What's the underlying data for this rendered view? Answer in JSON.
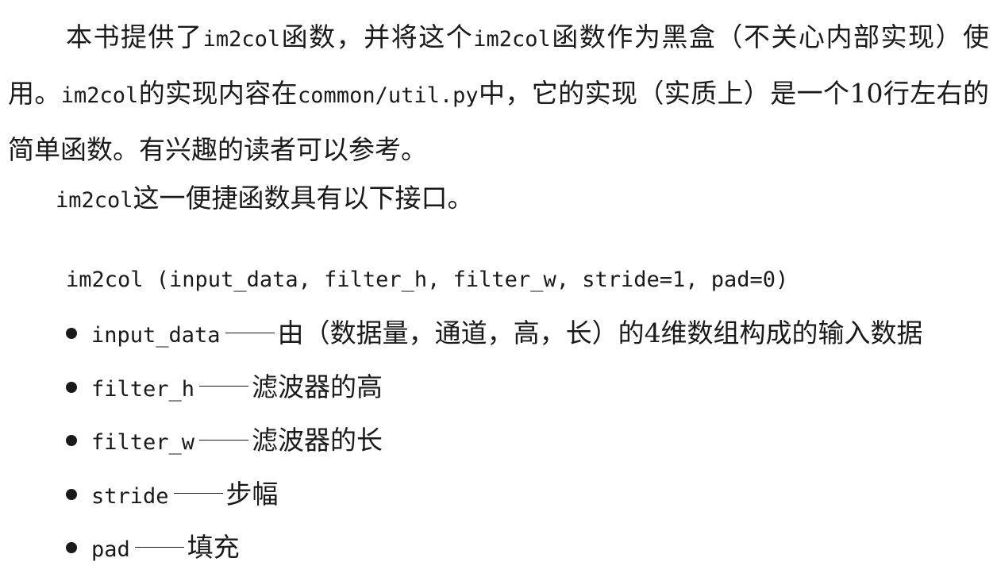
{
  "paragraph1": {
    "t1": "本书提供了",
    "c1": "im2col",
    "t2": "函数，并将这个",
    "c2": "im2col",
    "t3": "函数作为黑盒（不关心内部实现）使用。",
    "c3": "im2col",
    "t4": "的实现内容在",
    "c4": "common/util.py",
    "t5": "中，它的实现（实质上）是一个10行左右的简单函数。有兴趣的读者可以参考。"
  },
  "paragraph2": {
    "c1": "im2col",
    "t1": "这一便捷函数具有以下接口。"
  },
  "signature": "im2col (input_data, filter_h, filter_w, stride=1, pad=0)",
  "params": [
    {
      "name": "input_data",
      "desc": "由（数据量，通道，高，长）的4维数组构成的输入数据"
    },
    {
      "name": "filter_h",
      "desc": "滤波器的高"
    },
    {
      "name": "filter_w",
      "desc": "滤波器的长"
    },
    {
      "name": "stride",
      "desc": "步幅"
    },
    {
      "name": "pad",
      "desc": "填充"
    }
  ]
}
